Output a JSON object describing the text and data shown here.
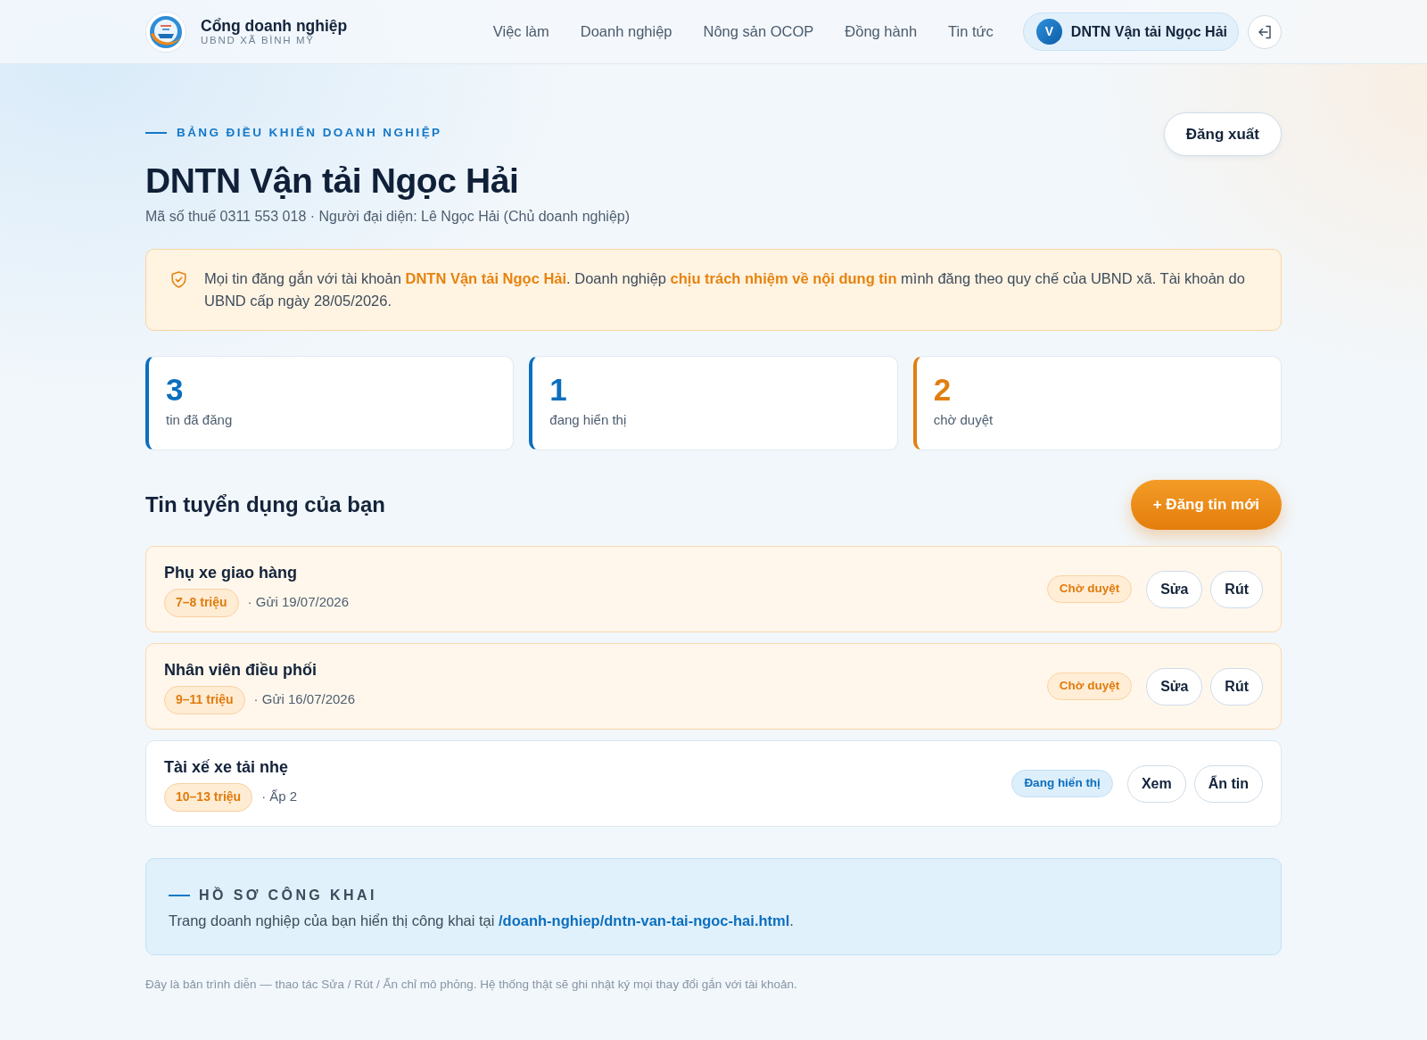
{
  "header": {
    "brand": {
      "title": "Cổng doanh nghiệp",
      "subtitle": "UBND XÃ BÌNH MỸ"
    },
    "nav": [
      "Việc làm",
      "Doanh nghiệp",
      "Nông sản OCOP",
      "Đồng hành",
      "Tin tức"
    ],
    "account": {
      "initial": "V",
      "name": "DNTN Vận tải Ngọc Hải"
    }
  },
  "page": {
    "eyebrow": "BẢNG ĐIỀU KHIỂN DOANH NGHIỆP",
    "logout_button": "Đăng xuất",
    "title": "DNTN Vận tải Ngọc Hải",
    "meta": "Mã số thuế 0311 553 018 · Người đại diện: Lê Ngọc Hải (Chủ doanh nghiệp)"
  },
  "notice": {
    "text": "Mọi tin đăng gắn với tài khoản **DNTN Vận tải Ngọc Hải**. Doanh nghiệp **chịu trách nhiệm về nội dung tin** mình đăng theo quy chế của UBND xã. Tài khoản do UBND cấp ngày 28/05/2026."
  },
  "stats": [
    {
      "value": "3",
      "label": "tin đã đăng",
      "color": "#0c6fbe"
    },
    {
      "value": "1",
      "label": "đang hiển thị",
      "color": "#0c6fbe"
    },
    {
      "value": "2",
      "label": "chờ duyệt",
      "color": "#e07f10"
    }
  ],
  "jobs_section": {
    "title": "Tin tuyển dụng của bạn",
    "new_button": "+ Đăng tin mới",
    "jobs": [
      {
        "kind": "pending",
        "title": "Phụ xe giao hàng",
        "salary": "7–8 triệu",
        "meta": "· Gửi 19/07/2026",
        "status": "Chờ duyệt",
        "actions": [
          "Sửa",
          "Rút"
        ]
      },
      {
        "kind": "pending",
        "title": "Nhân viên điều phối",
        "salary": "9–11 triệu",
        "meta": "· Gửi 16/07/2026",
        "status": "Chờ duyệt",
        "actions": [
          "Sửa",
          "Rút"
        ]
      },
      {
        "kind": "visible",
        "title": "Tài xế xe tải nhẹ",
        "salary": "10–13 triệu",
        "meta": "· Ấp 2",
        "status": "Đang hiển thị",
        "actions": [
          "Xem",
          "Ẩn tin"
        ]
      }
    ]
  },
  "public_profile": {
    "eyebrow": "HỒ SƠ CÔNG KHAI",
    "text": "Trang doanh nghiệp của bạn hiển thị công khai tại",
    "link": "/doanh-nghiep/dntn-van-tai-ngoc-hai.html",
    "after": "."
  },
  "footnote": "Đây là bản trình diễn — thao tác Sửa / Rút / Ẩn chỉ mô phỏng. Hệ thống thật sẽ ghi nhật ký mọi thay đổi gắn với tài khoản."
}
